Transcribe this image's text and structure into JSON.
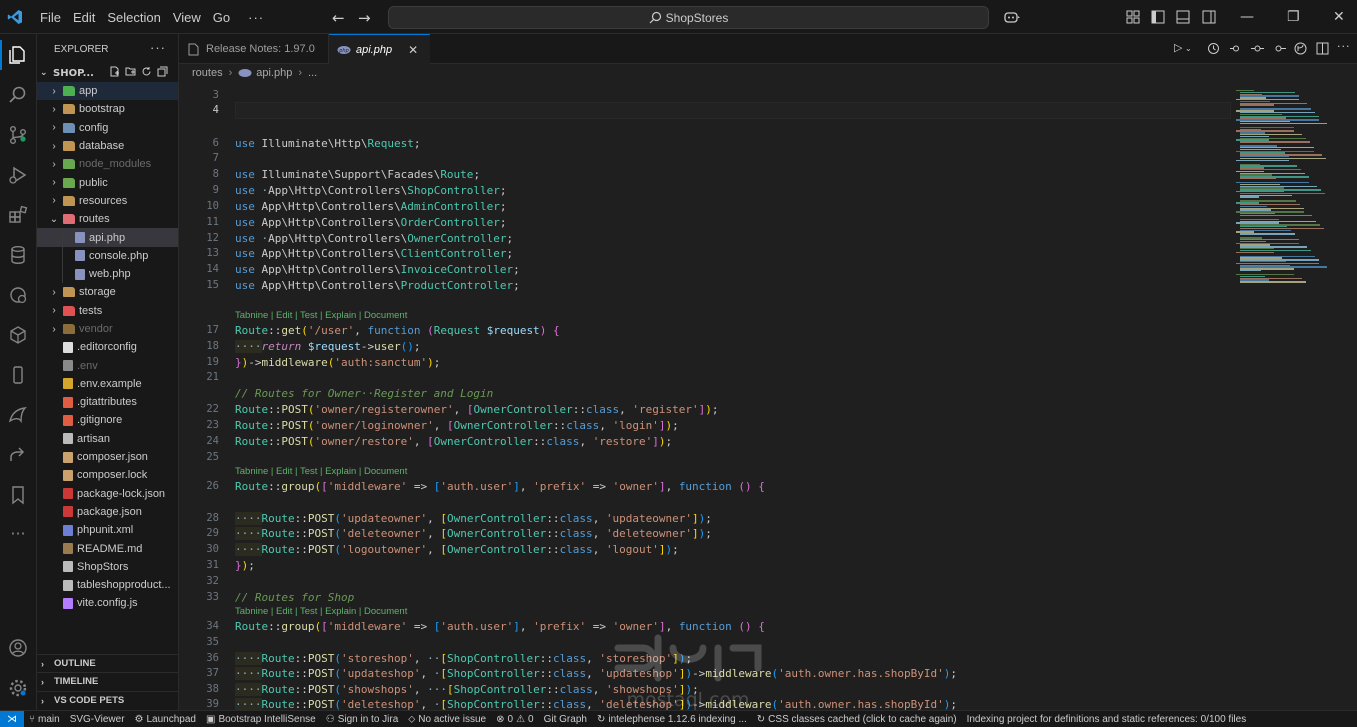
{
  "titlebar": {
    "menus": [
      "File",
      "Edit",
      "Selection",
      "View",
      "Go",
      "···"
    ],
    "search_text": "ShopStores"
  },
  "sidebar": {
    "title": "EXPLORER",
    "more": "···",
    "folder_name": "SHOP...",
    "items": [
      {
        "label": "app",
        "indent": 0,
        "chevron": "›",
        "icon_color": "#4caf50",
        "selected": true,
        "dim": false
      },
      {
        "label": "bootstrap",
        "indent": 0,
        "chevron": "›",
        "icon_color": "#c09553",
        "selected": false,
        "dim": false
      },
      {
        "label": "config",
        "indent": 0,
        "chevron": "›",
        "icon_color": "#6d8fb3",
        "selected": false,
        "dim": false
      },
      {
        "label": "database",
        "indent": 0,
        "chevron": "›",
        "icon_color": "#c09553",
        "selected": false,
        "dim": false
      },
      {
        "label": "node_modules",
        "indent": 0,
        "chevron": "›",
        "icon_color": "#6aa84f",
        "selected": false,
        "dim": true
      },
      {
        "label": "public",
        "indent": 0,
        "chevron": "›",
        "icon_color": "#6aa84f",
        "selected": false,
        "dim": false
      },
      {
        "label": "resources",
        "indent": 0,
        "chevron": "›",
        "icon_color": "#c09553",
        "selected": false,
        "dim": false
      },
      {
        "label": "routes",
        "indent": 0,
        "chevron": "⌄",
        "icon_color": "#e06c75",
        "selected": false,
        "dim": false
      },
      {
        "label": "api.php",
        "indent": 1,
        "chevron": "",
        "icon_color": "#8892bf",
        "selected": true,
        "dim": false
      },
      {
        "label": "console.php",
        "indent": 1,
        "chevron": "",
        "icon_color": "#8892bf",
        "selected": false,
        "dim": false
      },
      {
        "label": "web.php",
        "indent": 1,
        "chevron": "",
        "icon_color": "#8892bf",
        "selected": false,
        "dim": false
      },
      {
        "label": "storage",
        "indent": 0,
        "chevron": "›",
        "icon_color": "#c09553",
        "selected": false,
        "dim": false
      },
      {
        "label": "tests",
        "indent": 0,
        "chevron": "›",
        "icon_color": "#e05252",
        "selected": false,
        "dim": false
      },
      {
        "label": "vendor",
        "indent": 0,
        "chevron": "›",
        "icon_color": "#8a6d3b",
        "selected": false,
        "dim": true
      },
      {
        "label": ".editorconfig",
        "indent": 0,
        "chevron": "",
        "icon_color": "#dddddd",
        "selected": false,
        "dim": false
      },
      {
        "label": ".env",
        "indent": 0,
        "chevron": "",
        "icon_color": "#8a8a8a",
        "selected": false,
        "dim": true
      },
      {
        "label": ".env.example",
        "indent": 0,
        "chevron": "",
        "icon_color": "#d4a72c",
        "selected": false,
        "dim": false
      },
      {
        "label": ".gitattributes",
        "indent": 0,
        "chevron": "",
        "icon_color": "#e05d44",
        "selected": false,
        "dim": false
      },
      {
        "label": ".gitignore",
        "indent": 0,
        "chevron": "",
        "icon_color": "#e05d44",
        "selected": false,
        "dim": false
      },
      {
        "label": "artisan",
        "indent": 0,
        "chevron": "",
        "icon_color": "#bbbbbb",
        "selected": false,
        "dim": false
      },
      {
        "label": "composer.json",
        "indent": 0,
        "chevron": "",
        "icon_color": "#c9a26d",
        "selected": false,
        "dim": false
      },
      {
        "label": "composer.lock",
        "indent": 0,
        "chevron": "",
        "icon_color": "#c9a26d",
        "selected": false,
        "dim": false
      },
      {
        "label": "package-lock.json",
        "indent": 0,
        "chevron": "",
        "icon_color": "#cb3837",
        "selected": false,
        "dim": false
      },
      {
        "label": "package.json",
        "indent": 0,
        "chevron": "",
        "icon_color": "#cb3837",
        "selected": false,
        "dim": false
      },
      {
        "label": "phpunit.xml",
        "indent": 0,
        "chevron": "",
        "icon_color": "#6d7fd4",
        "selected": false,
        "dim": false
      },
      {
        "label": "README.md",
        "indent": 0,
        "chevron": "",
        "icon_color": "#9a7b4f",
        "selected": false,
        "dim": false
      },
      {
        "label": "ShopStors",
        "indent": 0,
        "chevron": "",
        "icon_color": "#bbbbbb",
        "selected": false,
        "dim": false
      },
      {
        "label": "tableshopproduct...",
        "indent": 0,
        "chevron": "",
        "icon_color": "#bbbbbb",
        "selected": false,
        "dim": false
      },
      {
        "label": "vite.config.js",
        "indent": 0,
        "chevron": "",
        "icon_color": "#b47cff",
        "selected": false,
        "dim": false
      }
    ],
    "panels": [
      "OUTLINE",
      "TIMELINE",
      "VS CODE PETS"
    ]
  },
  "tabs": [
    {
      "label": "Release Notes: 1.97.0",
      "active": false
    },
    {
      "label": "api.php",
      "active": true,
      "close": "✕"
    }
  ],
  "breadcrumb": [
    "routes",
    "api.php",
    "..."
  ],
  "editor": {
    "lens_text": "Tabnine | Edit | Test | Explain | Document",
    "current_line": "4",
    "line_numbers": [
      "3",
      "4",
      "6",
      "7",
      "8",
      "9",
      "10",
      "11",
      "12",
      "13",
      "14",
      "15",
      "17",
      "18",
      "19",
      "21",
      "22",
      "23",
      "24",
      "25",
      "26",
      "28",
      "29",
      "30",
      "31",
      "32",
      "33",
      "34",
      "35",
      "36",
      "37",
      "38",
      "39"
    ]
  },
  "statusbar": {
    "branch": "main",
    "items": [
      "SVG-Viewer",
      "Launchpad",
      "Bootstrap IntelliSense",
      "Sign in to Jira",
      "No active issue",
      "0",
      "0",
      "Git Graph",
      "intelephense 1.12.6 indexing ...",
      "CSS classes cached (click to cache again)",
      "Indexing project for definitions and static references: 0/100 files"
    ]
  },
  "watermark_text": "mostaql.com"
}
